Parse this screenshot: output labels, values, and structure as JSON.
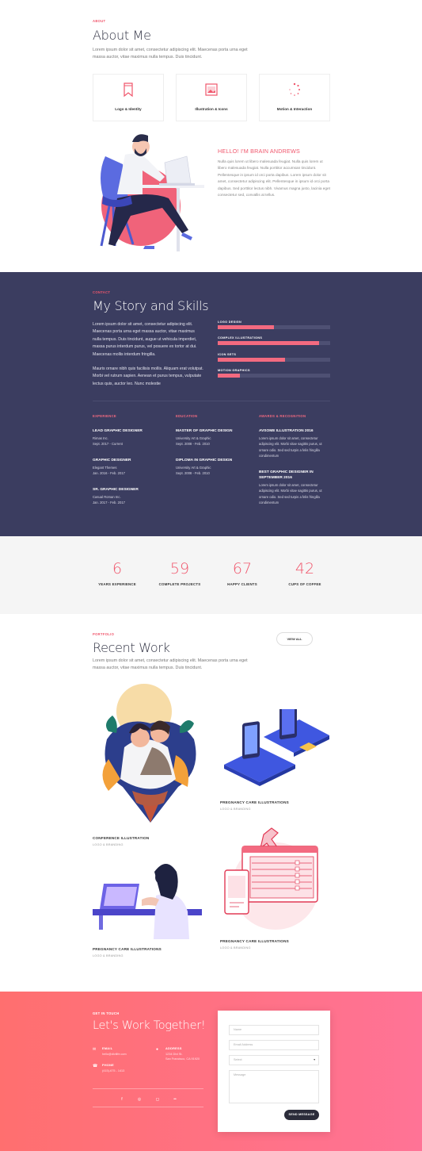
{
  "about": {
    "eyebrow": "ABOUT",
    "title": "About Me",
    "intro": "Lorem ipsum dolor sit amet, consectetur adipiscing elit. Maecenas porta urna eget massa auctor, vitae maximus nulla tempus. Duis tincidunt.",
    "services": [
      {
        "icon": "bookmark-icon",
        "label": "Logo & Identity"
      },
      {
        "icon": "image-icon",
        "label": "Illustration & Icons"
      },
      {
        "icon": "loader-icon",
        "label": "Motion & Interaction"
      }
    ],
    "hello": "HELLO! I'M BRAIN ANDREWS",
    "bio": "Nulla quis lorem ut libero malesuada feugiat. Nulla quis lorem ut libero malesuada feugiat. Nulla porttitor accumsan tincidunt. Pellentesque in ipsum id orci porta dapibus. Lorem ipsum dolor sit amet, consectetur adipiscing elit. Pellentesque in ipsum id orci porta dapibus. Sed porttitor lectus nibh. Vivamus magna justo, lacinia eget consectetur sed, convallis at tellus."
  },
  "story": {
    "eyebrow": "CONTACT",
    "title": "My Story and Skills",
    "p1": "Lorem ipsum dolor sit amet, consectetur adipiscing elit. Maecenas porta urna eget massa auctor, vitae maximus nulla tempus. Duis tincidunt, augue ut vehicula imperdiet, massa purus interdum purus, vel posuere ex tortor at dui. Maecenas mollis interdum fringilla.",
    "p2": "Mauris ornare nibh quis facilisis mollis. Aliquam erat volutpat. Morbi vel rutrum sapien. Aenean et purus tempus, vulputate lectus quis, auctor leo. Nunc molestie",
    "skills": [
      {
        "label": "LOGO DESIGN",
        "value": 0.5
      },
      {
        "label": "COMPLEX ILLUSTRATIONS",
        "value": 0.9
      },
      {
        "label": "ICON SETS",
        "value": 0.6
      },
      {
        "label": "MOTION GRAPHICS",
        "value": 0.2
      }
    ],
    "columns": {
      "experience": "EXPERIENCE",
      "education": "EDUCATION",
      "awards": "AWARDS & RECOGNITION"
    },
    "experience": [
      {
        "title": "LEAD GRAPHIC DESIGNER",
        "org": "Rimas Inc.",
        "dates": "Sept. 2017 - Current"
      },
      {
        "title": "GRAPHIC DESIGNER",
        "org": "Elegant Themes",
        "dates": "Jan. 2016 - Feb. 2017"
      },
      {
        "title": "SR. GRAPHIC DESIGNER",
        "org": "Casual Roman Inc.",
        "dates": "Jan. 2017 - Feb. 2017"
      }
    ],
    "education": [
      {
        "title": "MASTER OF GRAPHIC DESIGN",
        "org": "University Art & Graphic",
        "dates": "Sept. 2008 - Feb. 2010"
      },
      {
        "title": "DIPLOMA IN GRAPHIC DESIGN",
        "org": "University Art & Graphic",
        "dates": "Sept. 2008 - Feb. 2010"
      }
    ],
    "awards": [
      {
        "title": "AVSOME ILLUSTRATION 2016",
        "text": "Lorem ipsum dolor sit amet, consectetur adipiscing elit. Morbi vitae sagittis purus, ut ornare odio. Sed sed turpis a felis fringilla condimentum"
      },
      {
        "title": "BEST GRAPHIC DESIGNER IN SEPTEMBER 2016",
        "text": "Lorem ipsum dolor sit amet, consectetur adipiscing elit. Morbi vitae sagittis purus, ut ornare odio. Sed sed turpis a felis fringilla condimentum"
      }
    ]
  },
  "stats": [
    {
      "number": "6",
      "label": "YEARS EXPERIENCE"
    },
    {
      "number": "59",
      "label": "COMPLETE PROJECTS"
    },
    {
      "number": "67",
      "label": "HAPPY CLIENTS"
    },
    {
      "number": "42",
      "label": "CUPS OF COFFEE"
    }
  ],
  "work": {
    "eyebrow": "PORTFOLIO",
    "title": "Recent Work",
    "intro": "Lorem ipsum dolor sit amet, consectetur adipiscing elit. Maecenas porta urna eget massa auctor, vitae maximus nulla tempus. Duis tincidunt.",
    "view_all": "VIEW ALL",
    "projects": [
      {
        "title": "CONFERENCE ILLUSTRATION",
        "category": "LOGO & BRANDING"
      },
      {
        "title": "PREGNANCY CARE ILLUSTRATIONS",
        "category": "LOGO & BRANDING"
      },
      {
        "title": "PREGNANCY CARE ILLUSTRATIONS",
        "category": "LOGO & BRANDING"
      },
      {
        "title": "PREGNANCY CARE ILLUSTRATIONS",
        "category": "LOGO & BRANDING"
      }
    ]
  },
  "contact": {
    "eyebrow": "GET IN TOUCH",
    "title": "Let's Work Together!",
    "email_label": "EMAIL",
    "email": "hello@divilife.com",
    "phone_label": "PHONE",
    "phone": "(415)-675 - 1413",
    "address_label": "ADDRESS",
    "address_line1": "1234 Divi St.",
    "address_line2": "San Francisco, CA 91920",
    "social": [
      "facebook-icon",
      "dribbble-icon",
      "instagram-icon",
      "flickr-icon"
    ],
    "form": {
      "name": "Name",
      "email": "Email Address",
      "select": "Select",
      "message": "Message",
      "send": "SEND MESSAGE"
    }
  }
}
